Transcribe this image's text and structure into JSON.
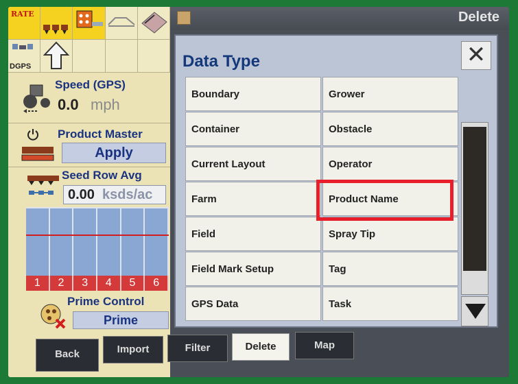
{
  "status_panel": {
    "rate_label": "RATE",
    "dgps_label": "DGPS",
    "speed": {
      "title": "Speed (GPS)",
      "value": "0.0",
      "unit": "mph"
    },
    "product_master": {
      "title": "Product Master",
      "button": "Apply"
    },
    "seed_row_avg": {
      "title": "Seed Row Avg",
      "value": "0.00",
      "unit": "ksds/ac"
    },
    "row_numbers": [
      "1",
      "2",
      "3",
      "4",
      "5",
      "6"
    ],
    "prime_control": {
      "title": "Prime Control",
      "button": "Prime"
    }
  },
  "header": {
    "delete_label": "Delete"
  },
  "dialog": {
    "title": "Data Type",
    "close_symbol": "✕",
    "items": [
      "Boundary",
      "Grower",
      "Container",
      "Obstacle",
      "Current Layout",
      "Operator",
      "Farm",
      "Product Name",
      "Field",
      "Spray Tip",
      "Field Mark Setup",
      "Tag",
      "GPS Data",
      "Task"
    ],
    "highlighted_item": "Product Name"
  },
  "tabs": [
    {
      "label": "Back"
    },
    {
      "label": "Import"
    },
    {
      "label": "Filter"
    },
    {
      "label": "Delete",
      "active": true
    },
    {
      "label": "Map"
    }
  ],
  "colors": {
    "highlight": "#e81e2a",
    "title": "#14387a",
    "status_bg": "#ebe3b6"
  }
}
